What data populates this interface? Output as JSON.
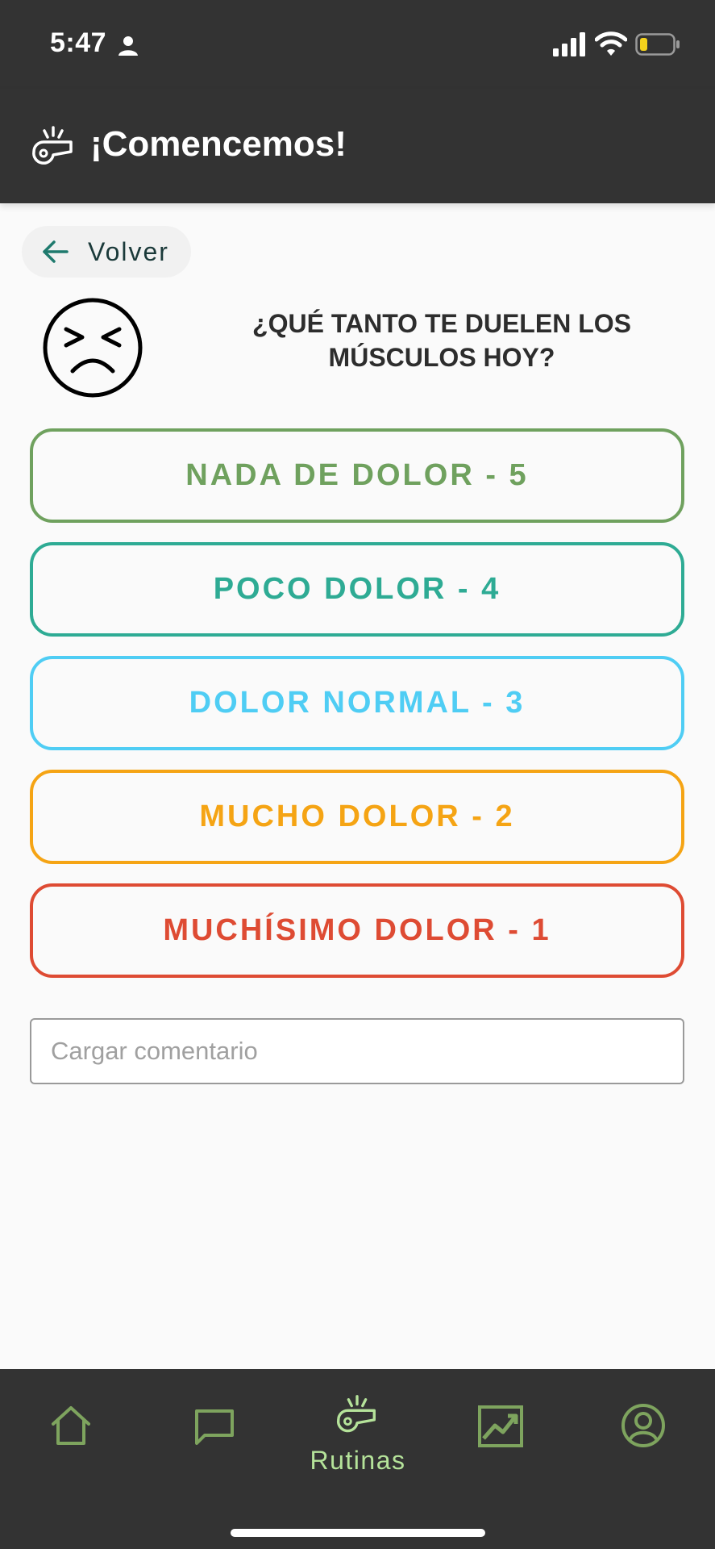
{
  "status_bar": {
    "time": "5:47",
    "icons": [
      "person-icon",
      "signal-icon",
      "wifi-icon",
      "battery-icon"
    ]
  },
  "app_bar": {
    "title": "¡Comencemos!",
    "icon": "whistle-icon"
  },
  "back_button": {
    "label": "Volver",
    "icon": "arrow-left-icon"
  },
  "question": {
    "icon": "pained-face-icon",
    "text": "¿QUÉ TANTO TE DUELEN LOS MÚSCULOS HOY?"
  },
  "options": [
    {
      "label": "NADA DE DOLOR - 5",
      "color": "#6fa15e"
    },
    {
      "label": "POCO DOLOR - 4",
      "color": "#2eab94"
    },
    {
      "label": "DOLOR NORMAL - 3",
      "color": "#4fcdf4"
    },
    {
      "label": "MUCHO DOLOR - 2",
      "color": "#f5a414"
    },
    {
      "label": "MUCHÍSIMO DOLOR - 1",
      "color": "#de4b33"
    }
  ],
  "comment": {
    "placeholder": "Cargar comentario",
    "value": ""
  },
  "bottom_nav": {
    "items": [
      {
        "name": "home-icon",
        "label": ""
      },
      {
        "name": "chat-icon",
        "label": ""
      },
      {
        "name": "whistle-icon",
        "label": "Rutinas",
        "active": true
      },
      {
        "name": "chart-icon",
        "label": ""
      },
      {
        "name": "profile-icon",
        "label": ""
      }
    ],
    "active_color": "#b5e39a",
    "inactive_color": "#7ea45e"
  }
}
